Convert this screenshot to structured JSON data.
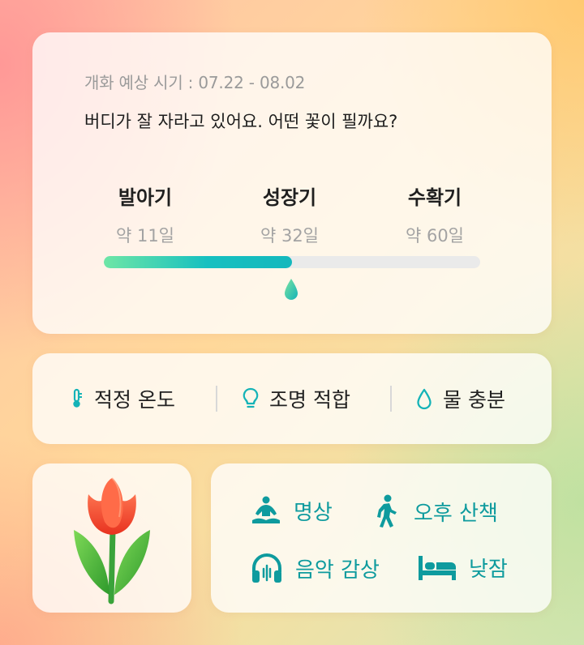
{
  "colors": {
    "accent": "#0e9b9e",
    "progress_start": "#6ee6a6",
    "progress_end": "#14b8bd"
  },
  "growth": {
    "bloom_period": "개화 예상 시기 : 07.22 - 08.02",
    "headline": "버디가 잘 자라고 있어요. 어떤 꽃이 필까요?",
    "stages": [
      {
        "name": "발아기",
        "days": "약 11일"
      },
      {
        "name": "성장기",
        "days": "약 32일"
      },
      {
        "name": "수확기",
        "days": "약 60일"
      }
    ],
    "progress": 0.5,
    "progress_icon": "water-drop-icon"
  },
  "status": [
    {
      "label": "적정 온도",
      "icon": "thermometer-icon"
    },
    {
      "label": "조명 적합",
      "icon": "lightbulb-icon"
    },
    {
      "label": "물 충분",
      "icon": "water-drop-icon"
    }
  ],
  "flower": {
    "icon": "tulip-icon"
  },
  "activities": [
    {
      "label": "명상",
      "icon": "meditation-icon"
    },
    {
      "label": "오후 산책",
      "icon": "walking-icon"
    },
    {
      "label": "음악 감상",
      "icon": "headphones-icon"
    },
    {
      "label": "낮잠",
      "icon": "bed-icon"
    }
  ]
}
